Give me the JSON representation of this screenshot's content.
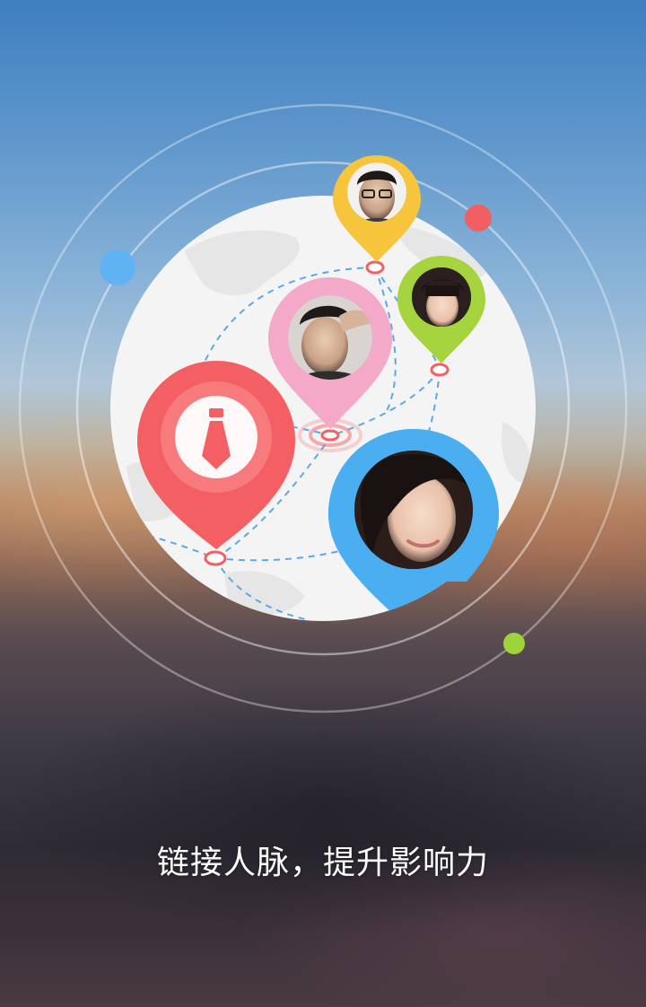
{
  "tagline": "链接人脉，提升影响力",
  "colors": {
    "pin_yellow": "#f7c53b",
    "pin_green": "#a6d43e",
    "pin_pink": "#f4a9c9",
    "pin_red": "#f35f63",
    "pin_blue": "#4aaef0",
    "dot_blue": "#5fb3f2",
    "dot_red": "#f25f63",
    "dot_green": "#9cd43a",
    "globe": "#f4f4f4",
    "route": "#5aa9e6"
  },
  "icons": {
    "center_pin": "necktie-icon"
  }
}
